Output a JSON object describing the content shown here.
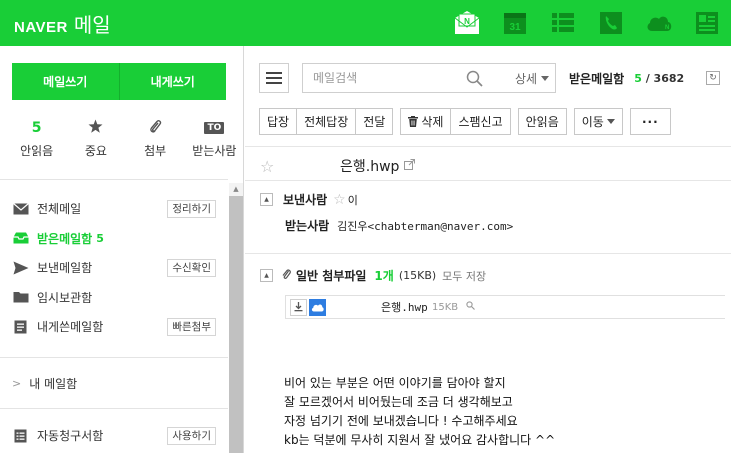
{
  "header": {
    "brand": "NAVER",
    "service": "메일",
    "icons": [
      "mail-n-icon",
      "calendar-icon",
      "contacts-list-icon",
      "phone-icon",
      "cloud-icon",
      "office-icon"
    ],
    "calendar_day": "31",
    "colors": {
      "primary": "#19ce37",
      "dark": "#0d8f1e"
    }
  },
  "sidebar": {
    "compose_label": "메일쓰기",
    "self_compose_label": "내게쓰기",
    "quick": [
      {
        "value": "5",
        "label": "안읽음"
      },
      {
        "icon": "star-icon",
        "label": "중요"
      },
      {
        "icon": "paperclip-icon",
        "label": "첨부"
      },
      {
        "badge": "TO",
        "label": "받는사람"
      }
    ],
    "folders": [
      {
        "icon": "envelope-icon",
        "label": "전체메일",
        "action": "정리하기"
      },
      {
        "icon": "inbox-icon",
        "label": "받은메일함",
        "count": "5",
        "active": true
      },
      {
        "icon": "send-icon",
        "label": "보낸메일함",
        "action": "수신확인"
      },
      {
        "icon": "folder-icon",
        "label": "임시보관함"
      },
      {
        "icon": "note-icon",
        "label": "내게쓴메일함",
        "action": "빠른첨부"
      }
    ],
    "my_mail": "내 메일함",
    "auto_folder": {
      "icon": "list-doc-icon",
      "label": "자동청구서함",
      "action": "사용하기"
    }
  },
  "toolbar": {
    "search_placeholder": "메일검색",
    "detail": "상세",
    "inbox_title": "받은메일함",
    "unread": "5",
    "total": "3682",
    "actions": {
      "reply": "답장",
      "reply_all": "전체답장",
      "forward": "전달",
      "delete": "삭제",
      "spam": "스팸신고",
      "unread": "안읽음",
      "move": "이동",
      "more": "···"
    }
  },
  "message": {
    "subject": "은행.hwp",
    "sender_label": "보낸사람",
    "sender": "이",
    "recipient_label": "받는사람",
    "recipient": "김진우<chabterman@naver.com>",
    "attach_label": "일반 첨부파일",
    "attach_count": "1개",
    "attach_size": "(15KB)",
    "save_all": "모두 저장",
    "file_name": "은행.hwp",
    "file_size": "15KB",
    "body": "비어 있는 부분은 어떤 이야기를 담아야 할지\n잘 모르겠어서 비어뒀는데 조금 더 생각해보고\n자정 넘기기 전에 보내겠습니다 ! 수고해주세요\nkb는 덕분에 무사히 지원서 잘 냈어요 감사합니다 ^^"
  }
}
